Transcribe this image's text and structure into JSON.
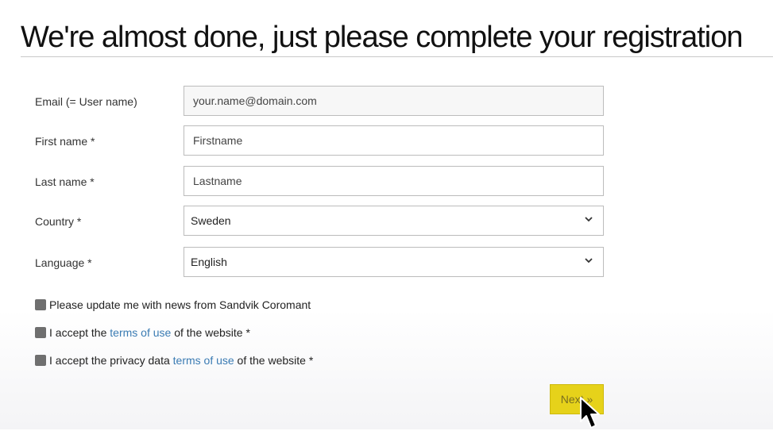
{
  "page": {
    "title": "We're almost done, just please complete your registration"
  },
  "form": {
    "email": {
      "label": "Email (= User name)",
      "value": "your.name@domain.com"
    },
    "first_name": {
      "label": "First name *",
      "placeholder": "Firstname"
    },
    "last_name": {
      "label": "Last name *",
      "placeholder": "Lastname"
    },
    "country": {
      "label": "Country *",
      "selected": "Sweden"
    },
    "language": {
      "label": "Language *",
      "selected": "English"
    }
  },
  "checkboxes": {
    "news": {
      "text": "Please update me with news from Sandvik Coromant",
      "checked": false
    },
    "terms": {
      "prefix": "I accept the ",
      "link": "terms of use",
      "suffix": " of the website *",
      "checked": false
    },
    "privacy": {
      "prefix": "I accept the privacy data ",
      "link": "terms of use",
      "suffix": " of the website *",
      "checked": false
    }
  },
  "actions": {
    "next_label": "Next »"
  },
  "colors": {
    "accent_yellow": "#e6d21a",
    "link_blue": "#3a7bb3",
    "checkbox_gray": "#6f6f6f"
  },
  "icons": {
    "select_arrow": "chevron-down-icon",
    "pointer": "mouse-cursor-icon"
  }
}
